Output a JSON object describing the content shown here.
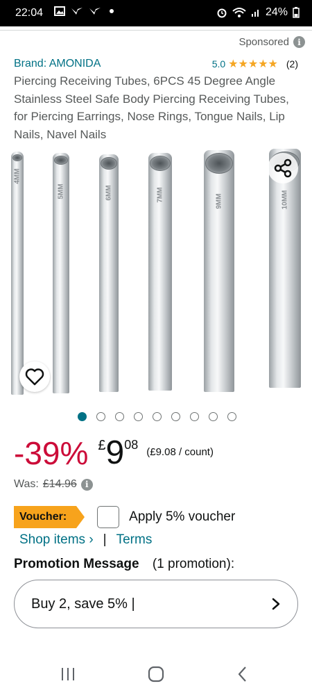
{
  "status_bar": {
    "time": "22:04",
    "battery": "24%"
  },
  "sponsored": {
    "label": "Sponsored"
  },
  "product": {
    "brand": "Brand: AMONIDA",
    "rating_score": "5.0",
    "stars": "★★★★★",
    "rating_count": "(2)",
    "title": "Piercing Receiving Tubes, 6PCS 45 Degree Angle Stainless Steel Safe Body Piercing Receiving Tubes, for Piercing Earrings, Nose Rings, Tongue Nails, Lip Nails, Navel Nails",
    "tube_labels": [
      "4MM",
      "5MM",
      "6MM",
      "7MM",
      "9MM",
      "10MM"
    ]
  },
  "gallery": {
    "image_count": 9,
    "active_index": 0
  },
  "price": {
    "discount": "-39%",
    "currency": "£",
    "whole": "9",
    "fraction": "08",
    "unit_price": "(£9.08 / count)",
    "was_label": "Was:",
    "was_price": "£14.96"
  },
  "voucher": {
    "tag": "Voucher:",
    "apply_label": "Apply 5% voucher",
    "shop_items": "Shop items ›",
    "separator": "|",
    "terms": "Terms"
  },
  "promotion": {
    "heading": "Promotion Message",
    "count": "(1 promotion):",
    "message": "Buy 2, save 5% |"
  },
  "colors": {
    "link": "#007185",
    "discount": "#cc0c39",
    "voucher": "#f7a31c",
    "star": "#f5a623"
  },
  "icons": [
    "image-icon",
    "share-icon",
    "heart-icon",
    "info-icon",
    "chevron-right-icon",
    "recent-apps-icon",
    "home-icon",
    "back-icon"
  ]
}
